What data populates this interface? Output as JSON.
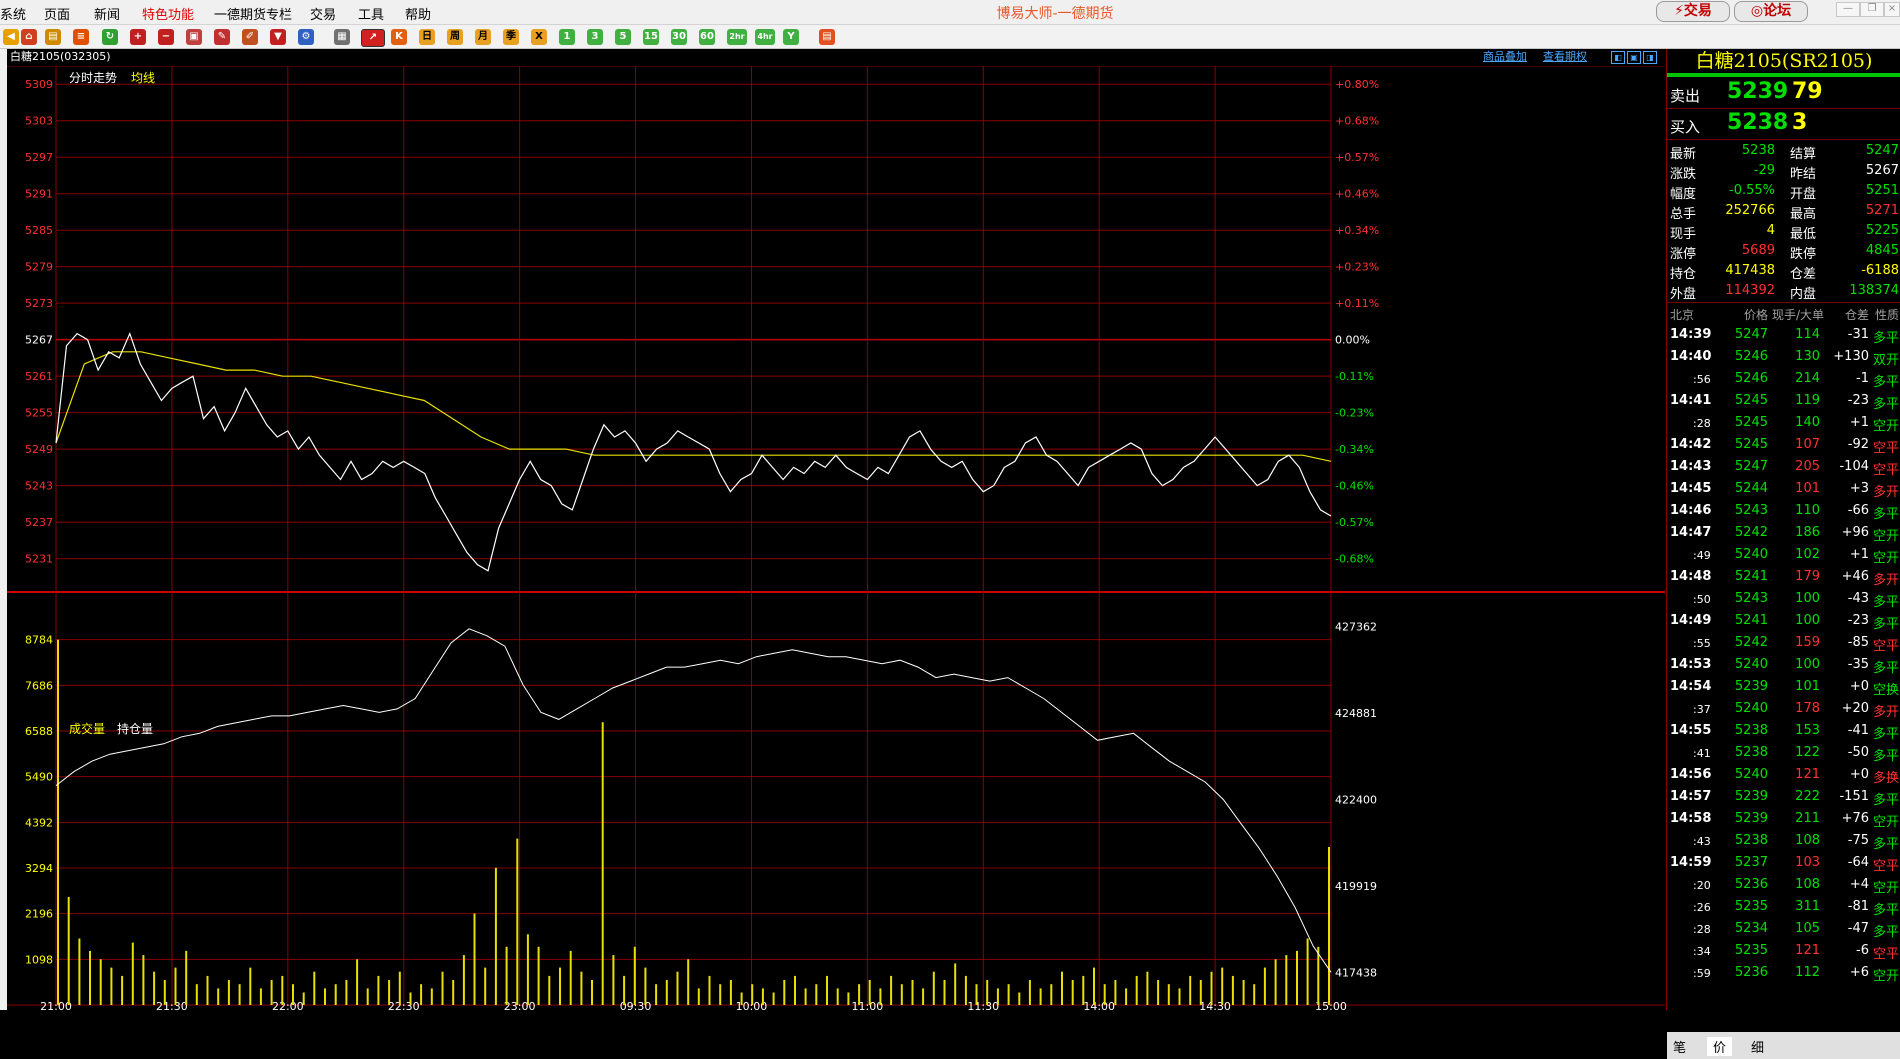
{
  "menubar": {
    "items": [
      "系统",
      "页面",
      "新闻",
      "特色功能",
      "一德期货专栏",
      "交易",
      "工具",
      "帮助"
    ],
    "title": "博易大师-一德期货",
    "trade_button": "交易",
    "forum_button": "论坛"
  },
  "toolbar": {
    "period_buttons": [
      "日",
      "周",
      "月",
      "季",
      "X",
      "1",
      "3",
      "5",
      "15",
      "30",
      "60",
      "2hr",
      "4hr",
      "Y"
    ]
  },
  "chart_header": {
    "title": "白糖2105(032305)",
    "link_overlay": "商品叠加",
    "link_options": "查看期权"
  },
  "price_pane": {
    "labels": {
      "trend": "分时走势",
      "avg": "均线"
    },
    "left_ticks": [
      "5309",
      "5303",
      "5297",
      "5291",
      "5285",
      "5279",
      "5273",
      "5267",
      "5261",
      "5255",
      "5249",
      "5243",
      "5237",
      "5231"
    ],
    "right_ticks": [
      "+0.80%",
      "+0.68%",
      "+0.57%",
      "+0.46%",
      "+0.34%",
      "+0.23%",
      "+0.11%",
      "0.00%",
      "-0.11%",
      "-0.23%",
      "-0.34%",
      "-0.46%",
      "-0.57%",
      "-0.68%"
    ]
  },
  "volume_pane": {
    "labels": {
      "vol": "成交量",
      "oi": "持仓量"
    },
    "left_ticks": [
      "8784",
      "7686",
      "6588",
      "5490",
      "4392",
      "3294",
      "2196",
      "1098"
    ],
    "right_ticks": [
      "427362",
      "424881",
      "422400",
      "419919",
      "417438"
    ]
  },
  "time_axis": [
    "21:00",
    "21:30",
    "22:00",
    "22:30",
    "23:00",
    "09:30",
    "10:00",
    "11:00",
    "11:30",
    "14:00",
    "14:30",
    "15:00"
  ],
  "chart_data": {
    "type": "line",
    "x_ticks": [
      "21:00",
      "21:30",
      "22:00",
      "22:30",
      "23:00",
      "09:30",
      "10:00",
      "11:00",
      "11:30",
      "14:00",
      "14:30",
      "15:00"
    ],
    "price_ylim": [
      5226,
      5312
    ],
    "prev_settle": 5267,
    "price": [
      5250,
      5266,
      5268,
      5267,
      5262,
      5265,
      5264,
      5268,
      5263,
      5260,
      5257,
      5259,
      5260,
      5261,
      5254,
      5256,
      5252,
      5255,
      5259,
      5256,
      5253,
      5251,
      5252,
      5249,
      5251,
      5248,
      5246,
      5244,
      5247,
      5244,
      5245,
      5247,
      5246,
      5247,
      5246,
      5245,
      5241,
      5238,
      5235,
      5232,
      5230,
      5229,
      5236,
      5240,
      5244,
      5247,
      5244,
      5243,
      5240,
      5239,
      5244,
      5249,
      5253,
      5251,
      5252,
      5250,
      5247,
      5249,
      5250,
      5252,
      5251,
      5250,
      5249,
      5245,
      5242,
      5244,
      5245,
      5248,
      5246,
      5244,
      5246,
      5245,
      5247,
      5246,
      5248,
      5246,
      5245,
      5244,
      5246,
      5245,
      5248,
      5251,
      5252,
      5249,
      5247,
      5246,
      5247,
      5244,
      5242,
      5243,
      5246,
      5247,
      5250,
      5251,
      5248,
      5247,
      5245,
      5243,
      5246,
      5247,
      5248,
      5249,
      5250,
      5249,
      5245,
      5243,
      5244,
      5246,
      5247,
      5249,
      5251,
      5249,
      5247,
      5245,
      5243,
      5244,
      5247,
      5248,
      5246,
      5242,
      5239,
      5238
    ],
    "avg": [
      5250,
      5263,
      5265,
      5265,
      5264,
      5263,
      5262,
      5262,
      5261,
      5261,
      5260,
      5259,
      5258,
      5257,
      5254,
      5251,
      5249,
      5249,
      5249,
      5248,
      5248,
      5248,
      5248,
      5248,
      5248,
      5248,
      5248,
      5248,
      5248,
      5248,
      5248,
      5248,
      5248,
      5248,
      5248,
      5248,
      5248,
      5248,
      5248,
      5248,
      5248,
      5248,
      5248,
      5248,
      5248,
      5247
    ],
    "volume_ylim": [
      0,
      9882
    ],
    "volume": [
      8784,
      2600,
      1600,
      1300,
      1100,
      900,
      700,
      1500,
      1200,
      800,
      600,
      900,
      1300,
      500,
      700,
      400,
      600,
      500,
      900,
      400,
      600,
      700,
      500,
      300,
      800,
      400,
      500,
      600,
      1100,
      400,
      700,
      600,
      800,
      300,
      500,
      400,
      800,
      600,
      1200,
      2200,
      900,
      3300,
      1400,
      4000,
      1700,
      1400,
      700,
      900,
      1300,
      800,
      600,
      6800,
      1200,
      700,
      1400,
      900,
      500,
      600,
      800,
      1100,
      400,
      700,
      500,
      600,
      300,
      500,
      400,
      300,
      600,
      700,
      400,
      500,
      700,
      400,
      300,
      500,
      600,
      400,
      700,
      500,
      600,
      400,
      800,
      600,
      1000,
      700,
      500,
      600,
      400,
      500,
      300,
      600,
      400,
      500,
      800,
      600,
      700,
      900,
      500,
      600,
      400,
      700,
      800,
      600,
      500,
      400,
      700,
      600,
      800,
      900,
      700,
      600,
      500,
      900,
      1100,
      1200,
      1300,
      1600,
      1400,
      3800
    ],
    "oi_ylim": [
      416500,
      428300
    ],
    "open_interest": [
      422800,
      423200,
      423500,
      423700,
      423800,
      423900,
      424000,
      424200,
      424300,
      424500,
      424600,
      424700,
      424800,
      424800,
      424900,
      425000,
      425100,
      425000,
      424900,
      425000,
      425300,
      426100,
      426900,
      427300,
      427100,
      426800,
      425700,
      424900,
      424700,
      425000,
      425300,
      425600,
      425800,
      426000,
      426200,
      426200,
      426300,
      426400,
      426300,
      426500,
      426600,
      426700,
      426600,
      426500,
      426500,
      426400,
      426300,
      426400,
      426200,
      425900,
      426000,
      425900,
      425800,
      425900,
      425600,
      425300,
      424900,
      424500,
      424100,
      424200,
      424300,
      423900,
      423500,
      423200,
      422900,
      422400,
      421700,
      421000,
      420200,
      419300,
      418200,
      417438
    ]
  },
  "quote_panel": {
    "title": "白糖2105(SR2105)",
    "ask": {
      "label": "卖出",
      "price": "5239",
      "volume": "79"
    },
    "bid": {
      "label": "买入",
      "price": "5238",
      "volume": "3"
    },
    "stats": [
      {
        "label": "最新",
        "value": "5238",
        "color": "#00e000",
        "label2": "结算",
        "value2": "5247",
        "color2": "#00e000"
      },
      {
        "label": "涨跌",
        "value": "-29",
        "color": "#00e000",
        "label2": "昨结",
        "value2": "5267",
        "color2": "#ffffff"
      },
      {
        "label": "幅度",
        "value": "-0.55%",
        "color": "#00e000",
        "label2": "开盘",
        "value2": "5251",
        "color2": "#00e000"
      },
      {
        "label": "总手",
        "value": "252766",
        "color": "#ffff00",
        "label2": "最高",
        "value2": "5271",
        "color2": "#ff3030"
      },
      {
        "label": "现手",
        "value": "4",
        "color": "#ffff00",
        "label2": "最低",
        "value2": "5225",
        "color2": "#00e000"
      },
      {
        "label": "涨停",
        "value": "5689",
        "color": "#ff3030",
        "label2": "跌停",
        "value2": "4845",
        "color2": "#00e000"
      },
      {
        "label": "持仓",
        "value": "417438",
        "color": "#ffff00",
        "label2": "仓差",
        "value2": "-6188",
        "color2": "#ffff00"
      },
      {
        "label": "外盘",
        "value": "114392",
        "color": "#ff3030",
        "label2": "内盘",
        "value2": "138374",
        "color2": "#00e000"
      }
    ],
    "tick_header": [
      "北京",
      "价格",
      "现手/大单",
      "仓差",
      "性质"
    ],
    "ticks": [
      {
        "time": "14:39",
        "price": "5247",
        "vol": "114",
        "oi": "-31",
        "nature": "多平",
        "nc": "#00e000"
      },
      {
        "time": "14:40",
        "price": "5246",
        "vol": "130",
        "oi": "+130",
        "nature": "双开",
        "nc": "#00e000"
      },
      {
        "time": ":56",
        "price": "5246",
        "vol": "214",
        "oi": "-1",
        "nature": "多平",
        "nc": "#00e000"
      },
      {
        "time": "14:41",
        "price": "5245",
        "vol": "119",
        "oi": "-23",
        "nature": "多平",
        "nc": "#00e000"
      },
      {
        "time": ":28",
        "price": "5245",
        "vol": "140",
        "oi": "+1",
        "nature": "空开",
        "nc": "#00e000"
      },
      {
        "time": "14:42",
        "price": "5245",
        "vol": "107",
        "oi": "-92",
        "nature": "空平",
        "nc": "#ff3030"
      },
      {
        "time": "14:43",
        "price": "5247",
        "vol": "205",
        "oi": "-104",
        "nature": "空平",
        "nc": "#ff3030"
      },
      {
        "time": "14:45",
        "price": "5244",
        "vol": "101",
        "oi": "+3",
        "nature": "多开",
        "nc": "#ff3030"
      },
      {
        "time": "14:46",
        "price": "5243",
        "vol": "110",
        "oi": "-66",
        "nature": "多平",
        "nc": "#00e000"
      },
      {
        "time": "14:47",
        "price": "5242",
        "vol": "186",
        "oi": "+96",
        "nature": "空开",
        "nc": "#00e000"
      },
      {
        "time": ":49",
        "price": "5240",
        "vol": "102",
        "oi": "+1",
        "nature": "空开",
        "nc": "#00e000"
      },
      {
        "time": "14:48",
        "price": "5241",
        "vol": "179",
        "oi": "+46",
        "nature": "多开",
        "nc": "#ff3030"
      },
      {
        "time": ":50",
        "price": "5243",
        "vol": "100",
        "oi": "-43",
        "nature": "多平",
        "nc": "#00e000"
      },
      {
        "time": "14:49",
        "price": "5241",
        "vol": "100",
        "oi": "-23",
        "nature": "多平",
        "nc": "#00e000"
      },
      {
        "time": ":55",
        "price": "5242",
        "vol": "159",
        "oi": "-85",
        "nature": "空平",
        "nc": "#ff3030"
      },
      {
        "time": "14:53",
        "price": "5240",
        "vol": "100",
        "oi": "-35",
        "nature": "多平",
        "nc": "#00e000"
      },
      {
        "time": "14:54",
        "price": "5239",
        "vol": "101",
        "oi": "+0",
        "nature": "空换",
        "nc": "#00e000"
      },
      {
        "time": ":37",
        "price": "5240",
        "vol": "178",
        "oi": "+20",
        "nature": "多开",
        "nc": "#ff3030"
      },
      {
        "time": "14:55",
        "price": "5238",
        "vol": "153",
        "oi": "-41",
        "nature": "多平",
        "nc": "#00e000"
      },
      {
        "time": ":41",
        "price": "5238",
        "vol": "122",
        "oi": "-50",
        "nature": "多平",
        "nc": "#00e000"
      },
      {
        "time": "14:56",
        "price": "5240",
        "vol": "121",
        "oi": "+0",
        "nature": "多换",
        "nc": "#ff3030"
      },
      {
        "time": "14:57",
        "price": "5239",
        "vol": "222",
        "oi": "-151",
        "nature": "多平",
        "nc": "#00e000"
      },
      {
        "time": "14:58",
        "price": "5239",
        "vol": "211",
        "oi": "+76",
        "nature": "空开",
        "nc": "#00e000"
      },
      {
        "time": ":43",
        "price": "5238",
        "vol": "108",
        "oi": "-75",
        "nature": "多平",
        "nc": "#00e000"
      },
      {
        "time": "14:59",
        "price": "5237",
        "vol": "103",
        "oi": "-64",
        "nature": "空平",
        "nc": "#ff3030"
      },
      {
        "time": ":20",
        "price": "5236",
        "vol": "108",
        "oi": "+4",
        "nature": "空开",
        "nc": "#00e000"
      },
      {
        "time": ":26",
        "price": "5235",
        "vol": "311",
        "oi": "-81",
        "nature": "多平",
        "nc": "#00e000"
      },
      {
        "time": ":28",
        "price": "5234",
        "vol": "105",
        "oi": "-47",
        "nature": "多平",
        "nc": "#00e000"
      },
      {
        "time": ":34",
        "price": "5235",
        "vol": "121",
        "oi": "-6",
        "nature": "空平",
        "nc": "#ff3030"
      },
      {
        "time": ":59",
        "price": "5236",
        "vol": "112",
        "oi": "+6",
        "nature": "空开",
        "nc": "#00e000"
      }
    ],
    "bottom_tabs": [
      "笔",
      "价",
      "细"
    ]
  },
  "colors": {
    "up": "#ff3030",
    "down": "#00e000",
    "avg_line": "#ffff00",
    "grid": "#8a0000"
  }
}
